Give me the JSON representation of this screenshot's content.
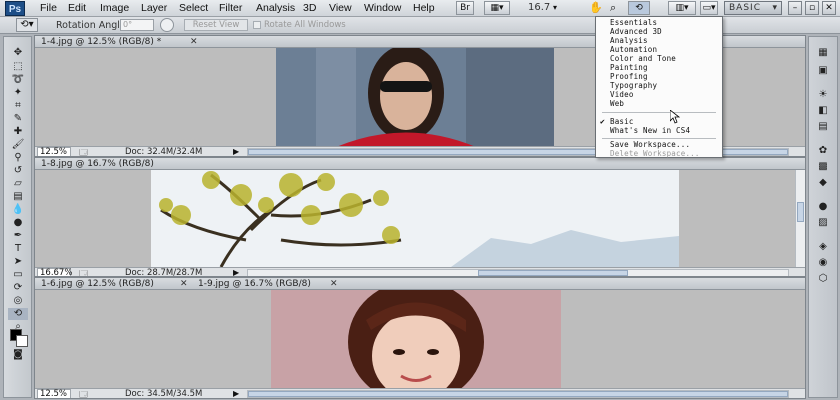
{
  "menubar": {
    "logo": "Ps",
    "items": [
      "File",
      "Edit",
      "Image",
      "Layer",
      "Select",
      "Filter",
      "Analysis",
      "3D",
      "View",
      "Window",
      "Help"
    ],
    "zoom": "16.7",
    "workspace_button": "BASIC"
  },
  "options": {
    "rotation_label": "Rotation Angle:",
    "rotation_value": "0°",
    "reset_view": "Reset View",
    "rotate_all": "Rotate All Windows"
  },
  "documents": [
    {
      "tab": "1-4.jpg @ 12.5% (RGB/8) *",
      "zoom": "12.5%",
      "doc": "Doc: 32.4M/32.4M"
    },
    {
      "tab": "1-8.jpg @ 16.7% (RGB/8)",
      "zoom": "16.67%",
      "doc": "Doc: 28.7M/28.7M"
    },
    {
      "tab": "1-6.jpg @ 12.5% (RGB/8)",
      "zoom": "12.5%",
      "doc": "Doc: 34.5M/34.5M"
    }
  ],
  "doc4_tab": "1-9.jpg @ 16.7% (RGB/8)",
  "workspace_menu": {
    "items": [
      "Essentials",
      "Advanced 3D",
      "Analysis",
      "Automation",
      "Color and Tone",
      "Painting",
      "Proofing",
      "Typography",
      "Video",
      "Web"
    ],
    "basic": "Basic",
    "whats_new": "What's New in CS4",
    "save": "Save Workspace...",
    "delete": "Delete Workspace..."
  }
}
